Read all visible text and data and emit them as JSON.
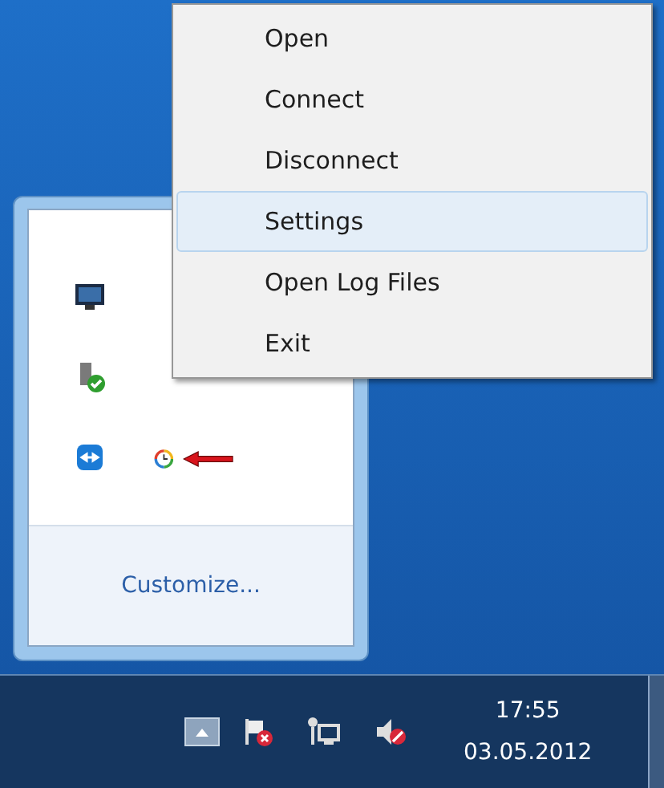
{
  "context_menu": {
    "items": [
      {
        "label": "Open",
        "selected": false
      },
      {
        "label": "Connect",
        "selected": false
      },
      {
        "label": "Disconnect",
        "selected": false
      },
      {
        "label": "Settings",
        "selected": true
      },
      {
        "label": "Open Log Files",
        "selected": false
      },
      {
        "label": "Exit",
        "selected": false
      }
    ]
  },
  "tray_flyout": {
    "customize_link": "Customize..."
  },
  "taskbar": {
    "clock": {
      "time": "17:55",
      "date": "03.05.2012"
    }
  }
}
